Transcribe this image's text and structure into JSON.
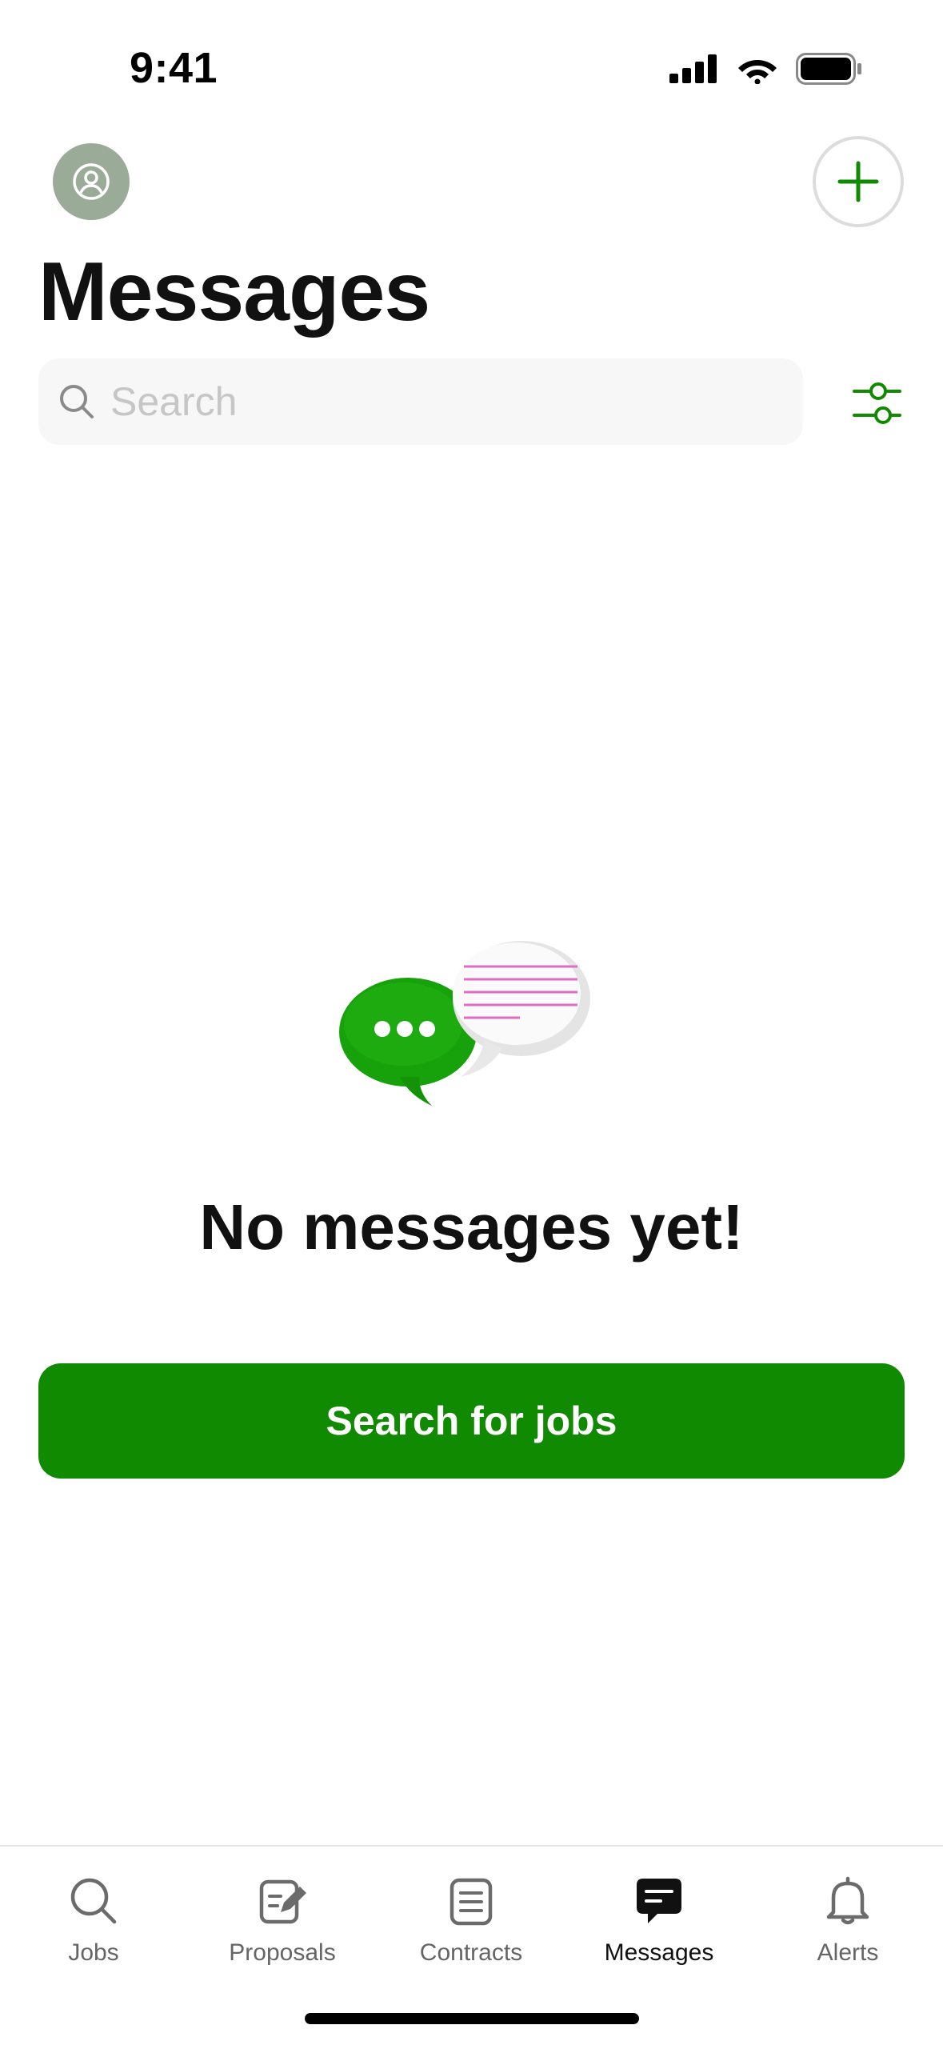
{
  "status_bar": {
    "time": "9:41"
  },
  "header": {
    "title": "Messages",
    "avatar_icon": "user-circle-icon",
    "compose_icon": "plus-icon"
  },
  "search": {
    "placeholder": "Search",
    "value": "",
    "filter_icon": "sliders-icon"
  },
  "empty_state": {
    "title": "No messages yet!",
    "illustration": "chat-bubbles-illustration",
    "button_label": "Search for jobs"
  },
  "tab_bar": {
    "items": [
      {
        "label": "Jobs",
        "icon": "search-icon",
        "active": false
      },
      {
        "label": "Proposals",
        "icon": "edit-document-icon",
        "active": false
      },
      {
        "label": "Contracts",
        "icon": "document-list-icon",
        "active": false
      },
      {
        "label": "Messages",
        "icon": "message-bubble-icon",
        "active": true
      },
      {
        "label": "Alerts",
        "icon": "bell-icon",
        "active": false
      }
    ]
  },
  "colors": {
    "brand_green": "#108a00",
    "avatar_bg": "#9aac98",
    "accent_pink": "#e06ec0"
  }
}
